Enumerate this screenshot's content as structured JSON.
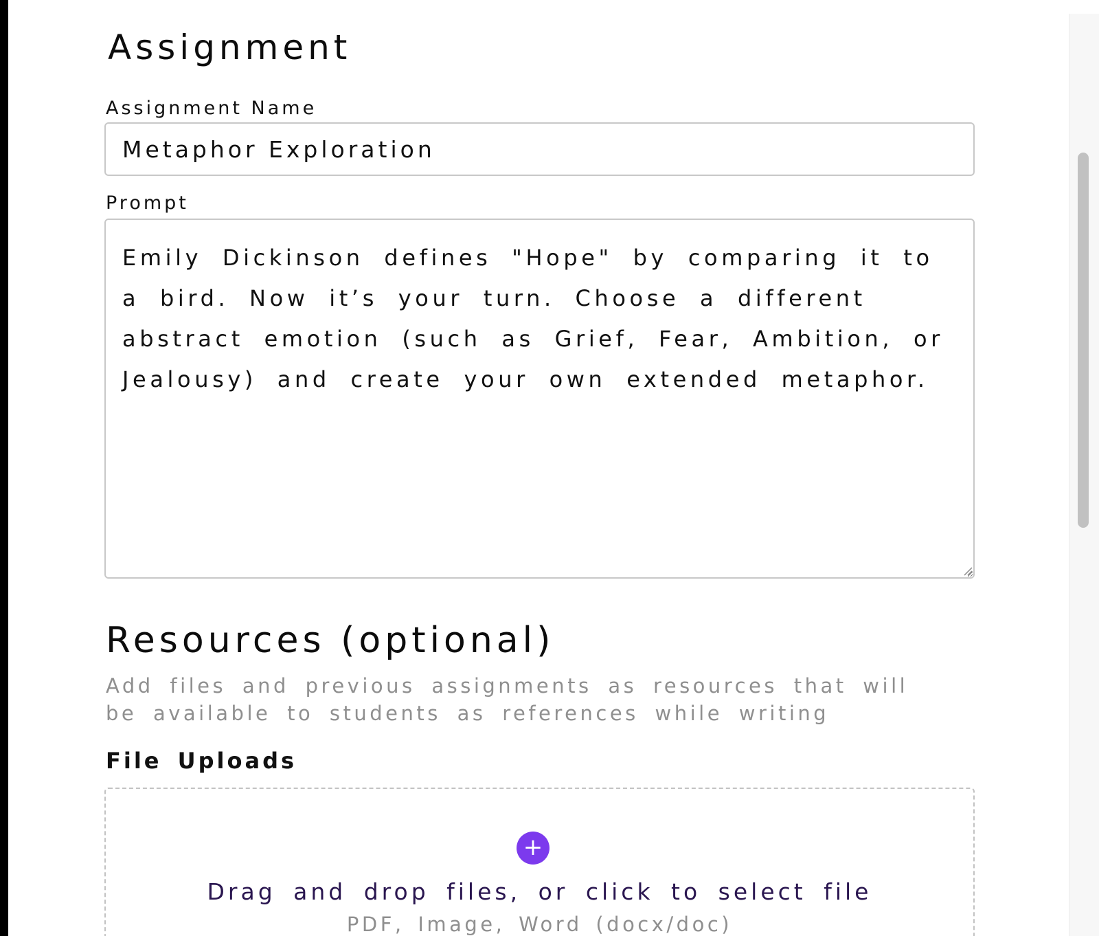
{
  "assignment": {
    "heading": "Assignment",
    "name_label": "Assignment Name",
    "name_value": "Metaphor Exploration",
    "prompt_label": "Prompt",
    "prompt_value": "Emily Dickinson defines \"Hope\" by comparing it to a bird. Now it’s your turn. Choose a different abstract emotion (such as Grief, Fear, Ambition, or Jealousy) and create your own extended metaphor."
  },
  "resources": {
    "heading": "Resources (optional)",
    "description": "Add files and previous assignments as resources that will be available to students as references while writing",
    "file_uploads_label": "File Uploads",
    "dropzone": {
      "icon": "plus-icon",
      "plus_glyph": "+",
      "title": "Drag and drop files, or click to select file",
      "subtitle": "PDF, Image, Word (docx/doc)"
    }
  },
  "colors": {
    "accent": "#7c3aed",
    "dropzone_title": "#2a1650",
    "muted_text": "#8f8f8f",
    "border": "#c8c8c8"
  }
}
